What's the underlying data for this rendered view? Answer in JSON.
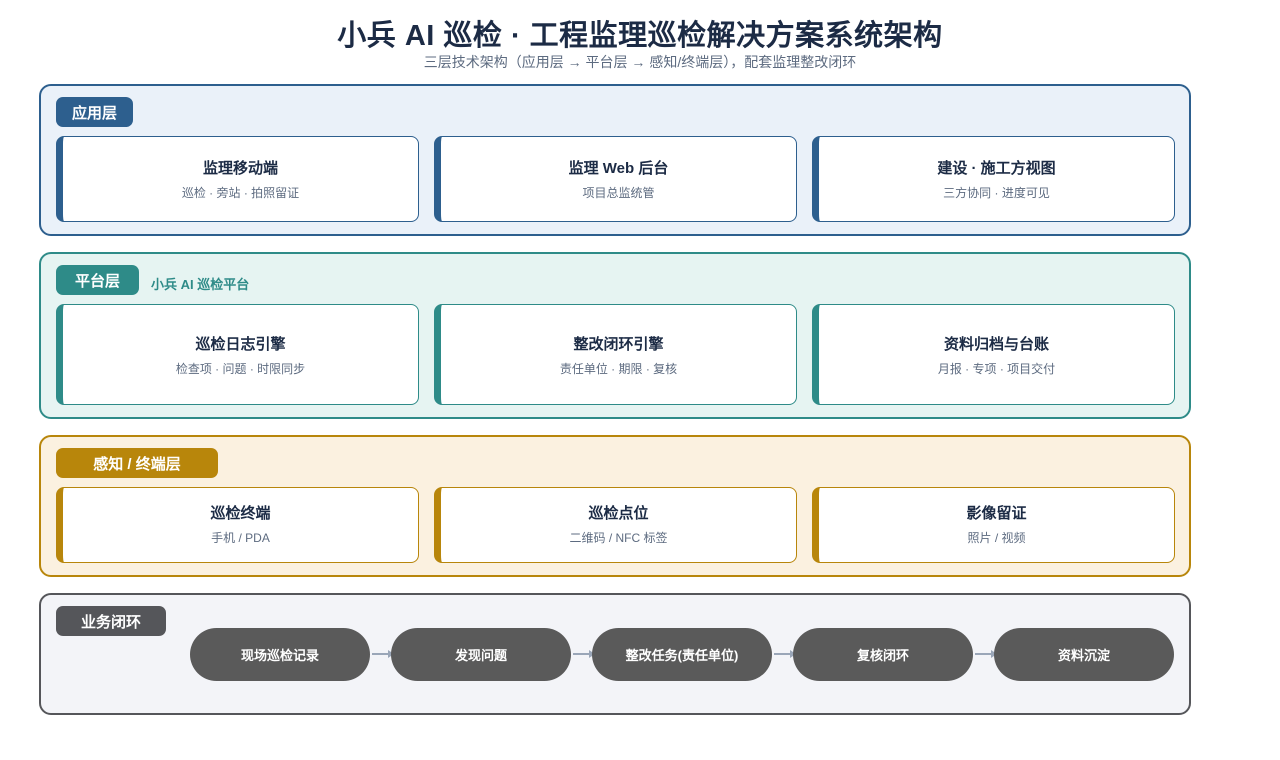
{
  "header": {
    "title": "小兵 AI 巡检 · 工程监理巡检解决方案系统架构",
    "subtitle": "三层技术架构（应用层 → 平台层 → 感知/终端层），配套监理整改闭环"
  },
  "app_layer": {
    "label": "应用层",
    "cards": [
      {
        "title": "监理移动端",
        "desc": "巡检 · 旁站 · 拍照留证"
      },
      {
        "title": "监理 Web 后台",
        "desc": "项目总监统管"
      },
      {
        "title": "建设 · 施工方视图",
        "desc": "三方协同 · 进度可见"
      }
    ]
  },
  "platform_layer": {
    "label": "平台层",
    "sublabel": "小兵 AI 巡检平台",
    "cards": [
      {
        "title": "巡检日志引擎",
        "desc": "检查项 · 问题 · 时限同步"
      },
      {
        "title": "整改闭环引擎",
        "desc": "责任单位 · 期限 · 复核"
      },
      {
        "title": "资料归档与台账",
        "desc": "月报 · 专项 · 项目交付"
      }
    ]
  },
  "sense_layer": {
    "label": "感知 / 终端层",
    "cards": [
      {
        "title": "巡检终端",
        "desc": "手机 / PDA"
      },
      {
        "title": "巡检点位",
        "desc": "二维码 / NFC 标签"
      },
      {
        "title": "影像留证",
        "desc": "照片 / 视频"
      }
    ]
  },
  "loop_layer": {
    "label": "业务闭环",
    "steps": [
      "现场巡检记录",
      "发现问题",
      "整改任务(责任单位)",
      "复核闭环",
      "资料沉淀"
    ]
  },
  "colors": {
    "app": "#2d5f8e",
    "platform": "#2e8b88",
    "sense": "#b8860b",
    "loop": "#55565a",
    "text_dark": "#1c2b45"
  }
}
